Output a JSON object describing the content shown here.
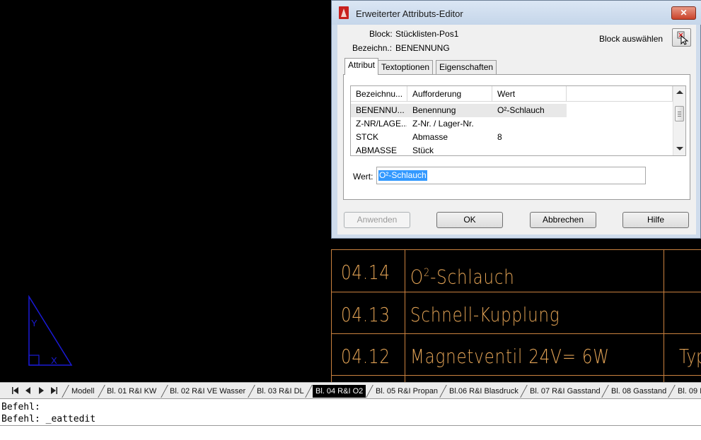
{
  "dialog": {
    "title": "Erweiterter Attributs-Editor",
    "block_label": "Block:",
    "block_value": "Stücklisten-Pos1",
    "tag_label": "Bezeichn.:",
    "tag_value": "BENENNUNG",
    "select_block_label": "Block auswählen",
    "close_label": "✕",
    "tabs": [
      "Attribut",
      "Textoptionen",
      "Eigenschaften"
    ],
    "columns": [
      "Bezeichnu...",
      "Aufforderung",
      "Wert"
    ],
    "rows": [
      [
        "BENENNU...",
        "Benennung",
        "O²-Schlauch"
      ],
      [
        "Z-NR/LAGE...",
        "Z-Nr. / Lager-Nr.",
        ""
      ],
      [
        "STCK",
        "Abmasse",
        "8"
      ],
      [
        "ABMASSE",
        "Stück",
        ""
      ]
    ],
    "value_label": "Wert:",
    "value": "O²-Schlauch",
    "buttons": {
      "apply": "Anwenden",
      "ok": "OK",
      "cancel": "Abbrechen",
      "help": "Hilfe"
    }
  },
  "bom": {
    "rows": [
      {
        "pos": "04.14",
        "name": "O",
        "sup": "2",
        "name_rest": "-Schlauch",
        "extra": ""
      },
      {
        "pos": "04.13",
        "name": "Schnell-Kupplung",
        "extra": ""
      },
      {
        "pos": "04.12",
        "name": "Magnetventil 24V= 6W",
        "extra": "Typ"
      }
    ]
  },
  "ucs": {
    "y_label": "Y",
    "x_label": "X"
  },
  "layout_tabs": [
    "Modell",
    "Bl. 01 R&I KW",
    "Bl. 02 R&I VE Wasser",
    "Bl. 03 R&I DL",
    "Bl. 04 R&I O2",
    "Bl. 05 R&I Propan",
    "Bl.06 R&I Blasdruck",
    "Bl. 07 R&I Gasstand",
    "Bl. 08 Gasstand",
    "Bl. 09 I"
  ],
  "active_layout_tab": "Bl. 04 R&I O2",
  "command": {
    "line1": "Befehl:",
    "line2": "Befehl: _eattedit"
  },
  "colors": {
    "drawing_bg": "#000000",
    "bom_text": "#e0a154",
    "ucs": "#1a1ad6",
    "selection": "#3399ff"
  }
}
